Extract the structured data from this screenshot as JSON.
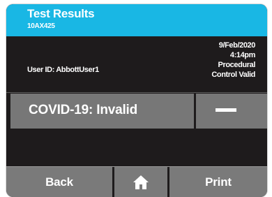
{
  "header": {
    "title": "Test Results",
    "subtitle": "10AX425"
  },
  "info": {
    "user_id": "User ID: AbbottUser1",
    "date": "9/Feb/2020",
    "time": "4:14pm",
    "control_line1": "Procedural",
    "control_line2": "Control Valid"
  },
  "result": {
    "label": "COVID-19: Invalid",
    "value_icon": "dash-icon"
  },
  "footer": {
    "back_label": "Back",
    "home_icon": "home-icon",
    "print_label": "Print"
  },
  "colors": {
    "header_bg": "#19b7e4",
    "screen_bg": "#1e1b1c",
    "result_bg": "#777777",
    "footer_bg": "#7a7a7a"
  }
}
